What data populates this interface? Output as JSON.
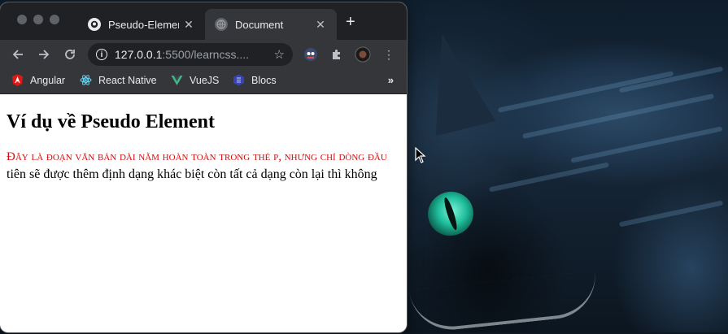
{
  "browser": {
    "tabs": [
      {
        "label": "Pseudo-Element",
        "active": false
      },
      {
        "label": "Document",
        "active": true
      }
    ],
    "new_tab_icon": "plus-icon",
    "url_host": "127.0.0.1",
    "url_rest": ":5500/learncss....",
    "bookmarks": [
      {
        "label": "Angular",
        "icon": "angular-icon",
        "color": "#dd1b16"
      },
      {
        "label": "React Native",
        "icon": "react-icon",
        "color": "#61dafb"
      },
      {
        "label": "VueJS",
        "icon": "vue-icon",
        "color": "#41b883"
      },
      {
        "label": "Blocs",
        "icon": "blocs-icon",
        "color": "#5b6bff"
      }
    ]
  },
  "page": {
    "heading": "Ví dụ về Pseudo Element",
    "paragraph_first_line": "Đây là đoạn văn bản dài nằm hoàn toàn trong thẻ p, nhưng chỉ dòng đầu",
    "paragraph_rest": "tiên sẽ được thêm định dạng khác biệt còn tất cả dạng còn lại thì không"
  },
  "colors": {
    "first_line_red": "#d10c0c",
    "chrome_dark": "#202124",
    "chrome_toolbar": "#35363a"
  }
}
